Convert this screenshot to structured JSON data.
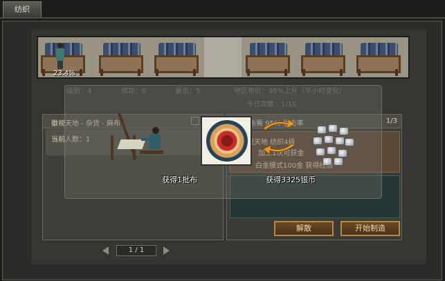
{
  "tab": {
    "label": "纺织"
  },
  "banner": {
    "progress_text": "23.4%",
    "progress": 0.234
  },
  "stats": {
    "level": "级别：4",
    "success": "成功：0",
    "crit": "暴击：5",
    "market": "地区布价：95%上升（半小时变化）",
    "daily": "今日次数：1/10"
  },
  "left_list": {
    "header": "徽视天地 - 杂货 - 麻布",
    "row_text": "当前人数：1"
  },
  "pager": {
    "text": "1 / 1"
  },
  "right_panel": {
    "header_left": "麻布需 95% 暴击率",
    "header_right": "1/3",
    "detail_line1": "徽视天地  纺织4级",
    "detail_line2": "加工1次可获金",
    "detail_line3": "白金模式100金  获得经验"
  },
  "buttons": {
    "disband": "解散",
    "start": "开始制造"
  },
  "popup": {
    "result_cloth": "获得1批布",
    "result_silver": "获得3325银币"
  },
  "icons": [
    "loom-icon",
    "weaver-icon",
    "medal-icon",
    "exchange-arrows-icon",
    "silver-ingots-icon"
  ]
}
